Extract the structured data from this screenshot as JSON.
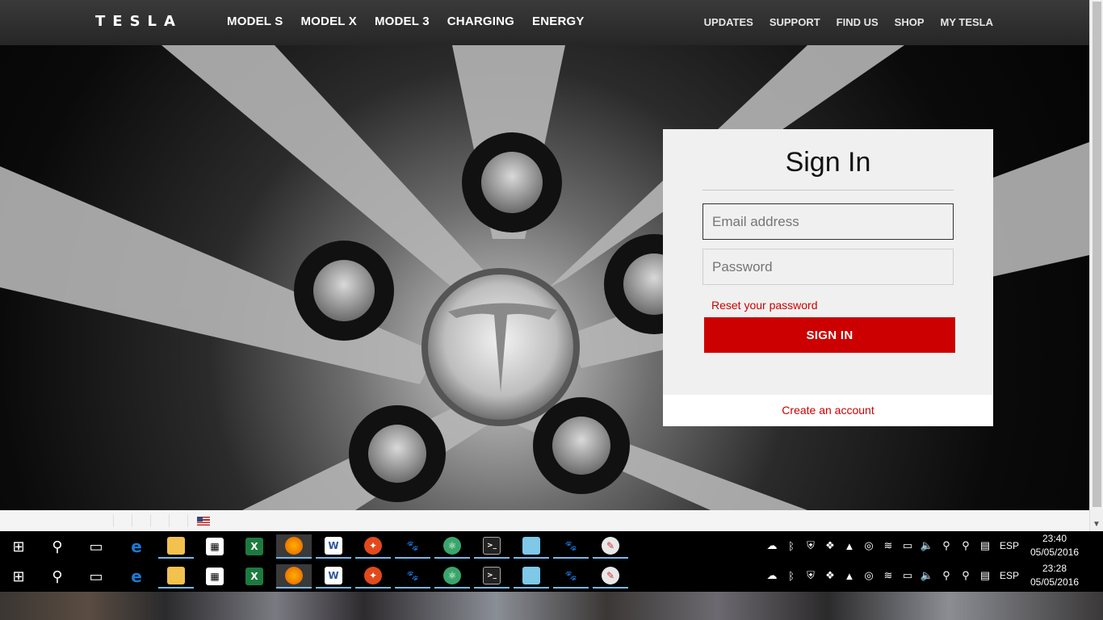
{
  "nav": {
    "logo": "TESLA",
    "main": [
      "MODEL S",
      "MODEL X",
      "MODEL 3",
      "CHARGING",
      "ENERGY"
    ],
    "sub": [
      "UPDATES",
      "SUPPORT",
      "FIND US",
      "SHOP",
      "MY TESLA"
    ]
  },
  "signin": {
    "title": "Sign In",
    "email_placeholder": "Email address",
    "password_placeholder": "Password",
    "reset_link": "Reset your password",
    "button": "SIGN IN",
    "create_link": "Create an account"
  },
  "taskbar": {
    "apps": [
      "start-icon",
      "search-icon",
      "task-view-icon",
      "edge-icon",
      "file-explorer-icon",
      "store-icon",
      "excel-icon",
      "firefox-icon",
      "word-icon",
      "rocket-app-icon",
      "gimp-icon",
      "atom-icon",
      "terminal-icon",
      "notepad-icon",
      "gimp-icon",
      "paint-icon"
    ],
    "language": "ESP",
    "clock_top": {
      "time": "23:40",
      "date": "05/05/2016"
    },
    "clock_bottom": {
      "time": "23:28",
      "date": "05/05/2016"
    }
  },
  "colors": {
    "accent_red": "#cc0000",
    "nav_bg": "#2f2f2f"
  }
}
